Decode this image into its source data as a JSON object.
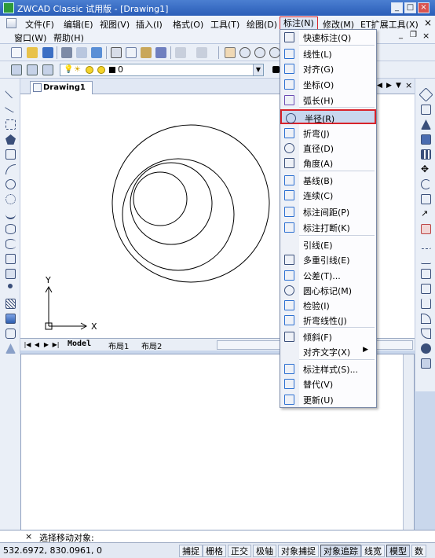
{
  "app": {
    "title": "ZWCAD Classic 试用版 - [Drawing1]"
  },
  "menubar": {
    "row1": [
      "文件(F)",
      "编辑(E)",
      "视图(V)",
      "插入(I)",
      "格式(O)",
      "工具(T)",
      "绘图(D)",
      "标注(N)",
      "修改(M)",
      "ET扩展工具(X)"
    ],
    "row2": [
      "窗口(W)",
      "帮助(H)"
    ],
    "active": "标注(N)"
  },
  "toolbar2": {
    "layer_value": "0"
  },
  "drawing_tab": "Drawing1",
  "layout_tabs": [
    "Model",
    "布局1",
    "布局2"
  ],
  "axis": {
    "x": "X",
    "y": "Y"
  },
  "dimension_menu": {
    "items": [
      {
        "label": "快速标注(Q)",
        "icon": "quick-dimension-icon"
      },
      {
        "label": "线性(L)",
        "icon": "linear-icon"
      },
      {
        "label": "对齐(G)",
        "icon": "aligned-icon"
      },
      {
        "label": "坐标(O)",
        "icon": "ordinate-icon"
      },
      {
        "label": "弧长(H)",
        "icon": "arc-length-icon"
      },
      {
        "label": "半径(R)",
        "icon": "radius-icon",
        "selected": true
      },
      {
        "label": "折弯(J)",
        "icon": "jogged-icon"
      },
      {
        "label": "直径(D)",
        "icon": "diameter-icon"
      },
      {
        "label": "角度(A)",
        "icon": "angular-icon"
      },
      {
        "label": "基线(B)",
        "icon": "baseline-icon"
      },
      {
        "label": "连续(C)",
        "icon": "continue-icon"
      },
      {
        "label": "标注间距(P)",
        "icon": "dimension-space-icon"
      },
      {
        "label": "标注打断(K)",
        "icon": "dimension-break-icon"
      },
      {
        "label": "引线(E)",
        "icon": ""
      },
      {
        "label": "多重引线(E)",
        "icon": "multileader-icon"
      },
      {
        "label": "公差(T)...",
        "icon": "tolerance-icon"
      },
      {
        "label": "圆心标记(M)",
        "icon": "center-mark-icon"
      },
      {
        "label": "检验(I)",
        "icon": "inspection-icon"
      },
      {
        "label": "折弯线性(J)",
        "icon": "jogged-linear-icon"
      },
      {
        "label": "倾斜(F)",
        "icon": "oblique-icon"
      },
      {
        "label": "对齐文字(X)",
        "icon": "",
        "submenu": true
      },
      {
        "label": "标注样式(S)...",
        "icon": "dimension-style-icon"
      },
      {
        "label": "替代(V)",
        "icon": "override-icon"
      },
      {
        "label": "更新(U)",
        "icon": "update-icon"
      }
    ]
  },
  "command": {
    "prompt": "选择移动对象:"
  },
  "status": {
    "coords": "532.6972,  830.0961,  0",
    "buttons": [
      "捕捉",
      "栅格",
      "正交",
      "极轴",
      "对象捕捉",
      "对象追踪",
      "线宽",
      "模型",
      "数"
    ]
  },
  "colors": {
    "accent": "#d8232a",
    "titlebar": "#2a5db8",
    "selection": "#c8d7ee"
  }
}
